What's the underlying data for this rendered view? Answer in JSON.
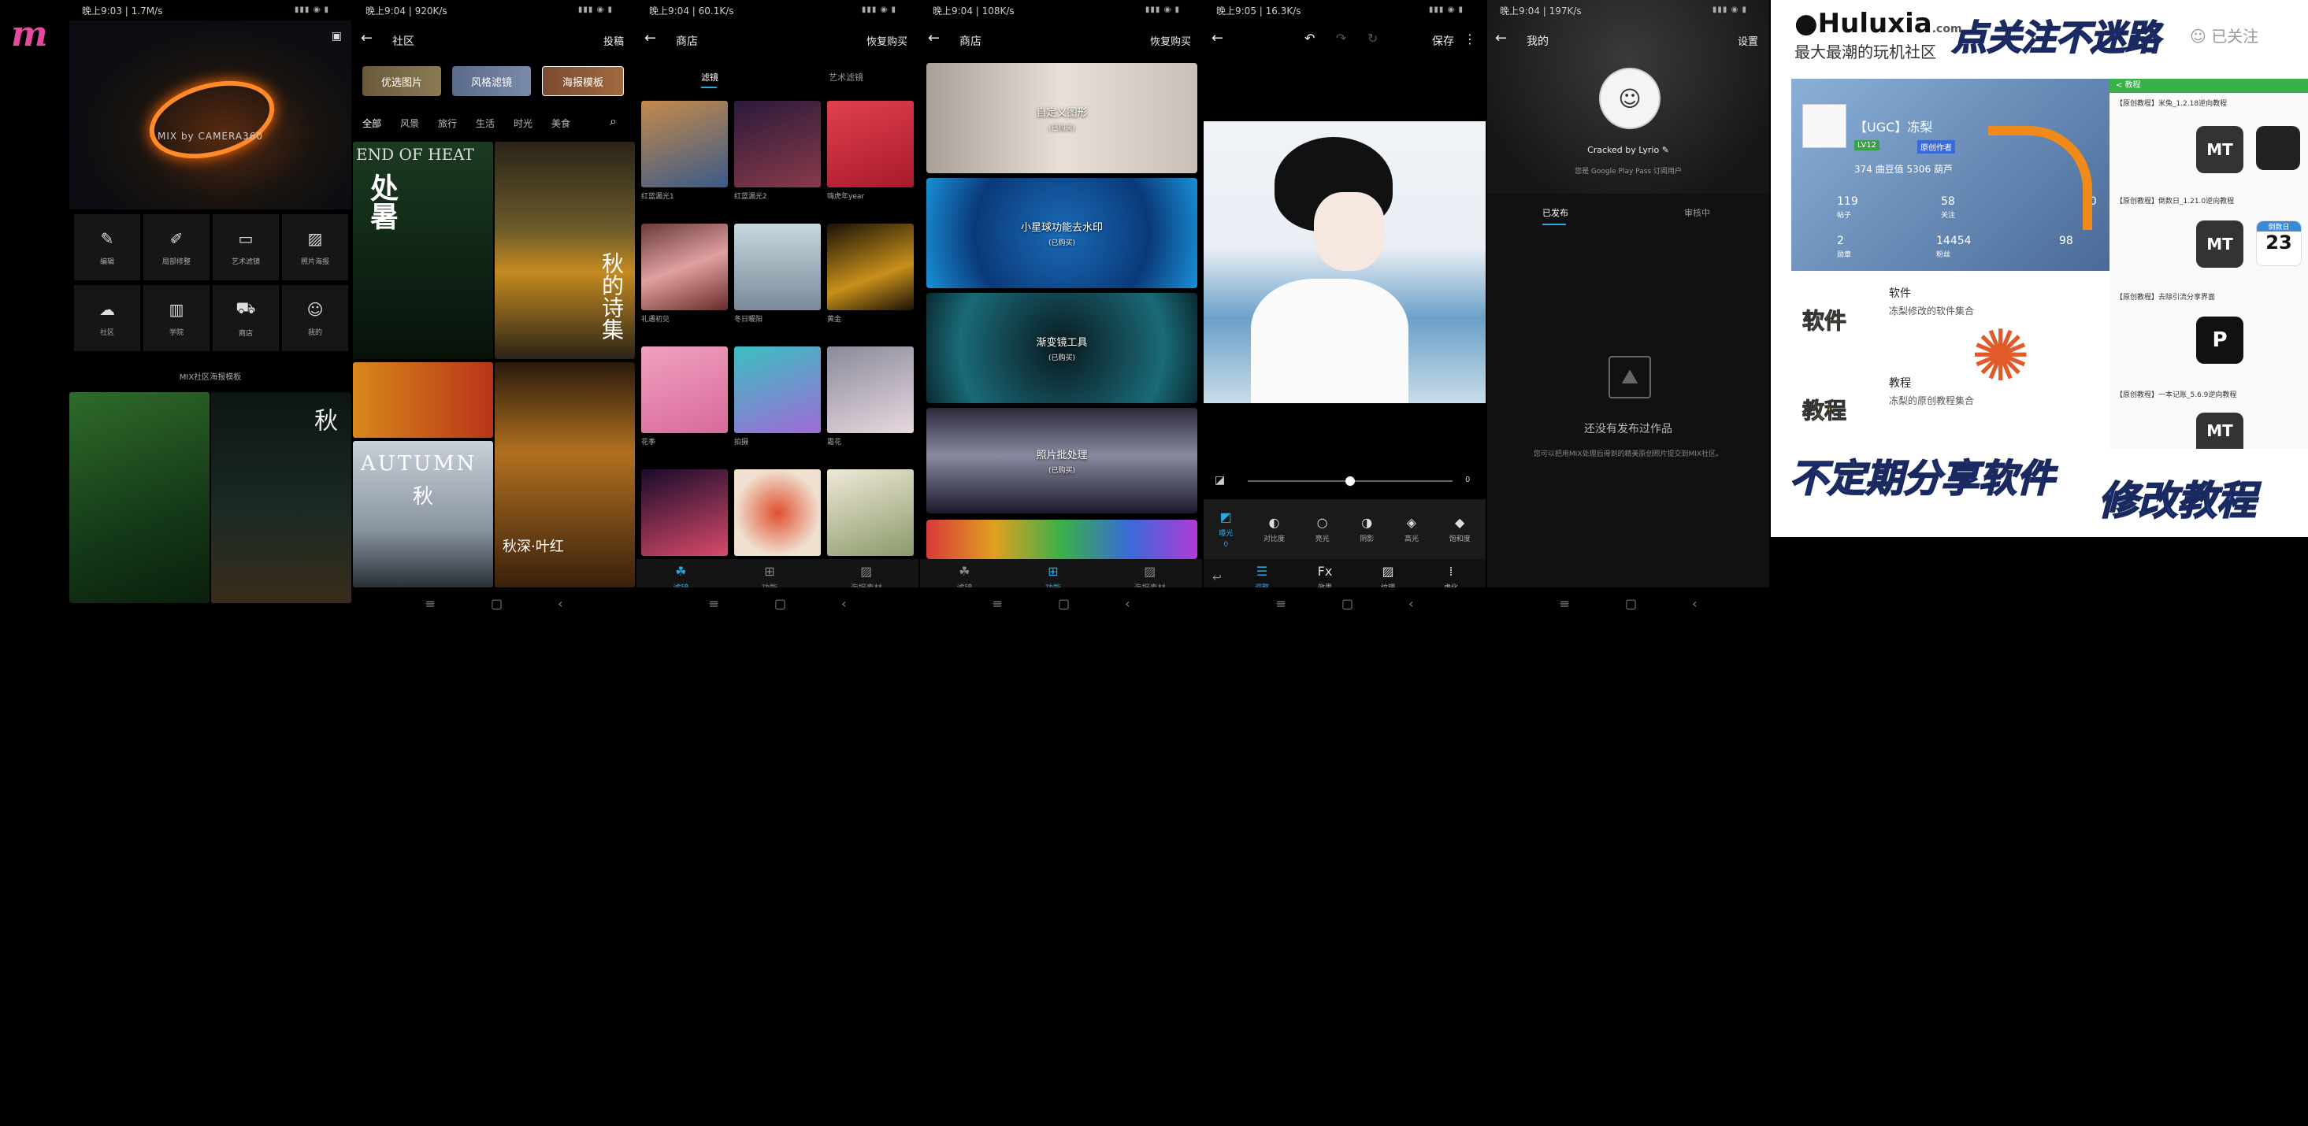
{
  "logo_glyph": "m",
  "status": {
    "p1": "晚上9:03 | 1.7M/s",
    "p2": "晚上9:04 | 920K/s",
    "p3": "晚上9:04 | 60.1K/s",
    "p4": "晚上9:04 | 108K/s",
    "p5": "晚上9:05 | 16.3K/s",
    "p6": "晚上9:04 | 197K/s"
  },
  "home": {
    "brand": "MIX by CAMERA360",
    "functions": [
      "编辑",
      "局部修整",
      "艺术滤镜",
      "照片海报",
      "社区",
      "学院",
      "商店",
      "我的"
    ],
    "section_title": "MIX社区海报模板"
  },
  "community": {
    "title": "社区",
    "post": "投稿",
    "chips": [
      "优选图片",
      "风格滤镜",
      "海报模板"
    ],
    "categories": [
      "全部",
      "风景",
      "旅行",
      "生活",
      "时光",
      "美食"
    ],
    "poster_texts": [
      "END OF HEAT",
      "处暑",
      "秋的诗集",
      "AUTUMN",
      "秋",
      "秋深·叶红"
    ]
  },
  "store1": {
    "title": "商店",
    "restore": "恢复购买",
    "tabs": [
      "滤镜",
      "艺术滤镜"
    ],
    "items": [
      "红蓝漏光1",
      "红蓝漏光2",
      "嗨虎年year",
      "礼遇初见",
      "冬日暖阳",
      "黄金",
      "花季",
      "拍摄",
      "霜花"
    ],
    "tabbar": [
      "滤镜",
      "功能",
      "海报素材"
    ]
  },
  "store2": {
    "title": "商店",
    "restore": "恢复购买",
    "promos": [
      {
        "title": "自定义图形",
        "sub": "(已购买)"
      },
      {
        "title": "小星球功能去水印",
        "sub": "(已购买)"
      },
      {
        "title": "渐变镜工具",
        "sub": "(已购买)"
      },
      {
        "title": "照片批处理",
        "sub": "(已购买)"
      }
    ],
    "tabbar": [
      "滤镜",
      "功能",
      "海报素材"
    ]
  },
  "editor": {
    "save": "保存",
    "slider_value": "0",
    "slider_level": 0.5,
    "tools": [
      "曝光",
      "对比度",
      "亮光",
      "阴影",
      "高光",
      "饱和度"
    ],
    "tool_value": "0",
    "bottom_tabs": [
      "调整",
      "效果",
      "纹理",
      "虚化"
    ]
  },
  "profile": {
    "title": "我的",
    "settings": "设置",
    "username": "Cracked by Lyrio",
    "subtitle": "您是 Google Play Pass 订阅用户",
    "tabs": [
      "已发布",
      "审核中"
    ],
    "empty_title": "还没有发布过作品",
    "empty_desc": "您可以把用MIX处理后得到的精美原创照片提交到MIX社区。"
  },
  "ad": {
    "logo_text": "Huluxia",
    "logo_com": ".com",
    "slogan": "最大最潮的玩机社区",
    "follow_banner": "点关注不迷路",
    "followed": "已关注",
    "user_name": "【UGC】冻梨",
    "level": "LV12",
    "badge": "原创作者",
    "stats_line": "374 曲豆值  5306 葫芦",
    "stats": [
      [
        "119",
        "帖子"
      ],
      [
        "58",
        "关注"
      ],
      [
        "10",
        ""
      ],
      [
        "2",
        "勋章"
      ],
      [
        "14454",
        "粉丝"
      ],
      [
        "98",
        ""
      ]
    ],
    "list_header": "< 教程",
    "posts": [
      "【原创教程】米兔_1.2.18逆向教程",
      "【原创教程】倒数日_1.21.0逆向教程",
      "【原创教程】去除引流分享界面",
      "【原创教程】一本记账_5.6.9逆向教程"
    ],
    "tile_labels": [
      "MT",
      "MT",
      "MT"
    ],
    "countdown_label": "倒数日",
    "countdown_value": "23",
    "cat_soft_title": "软件",
    "cat_soft_desc": "冻梨修改的软件集合",
    "cat_soft_sticker": "软件",
    "cat_tut_title": "教程",
    "cat_tut_desc": "冻梨的原创教程集合",
    "cat_tut_sticker": "教程",
    "bottom_left": "不定期分享软件",
    "bottom_right": "修改教程"
  }
}
